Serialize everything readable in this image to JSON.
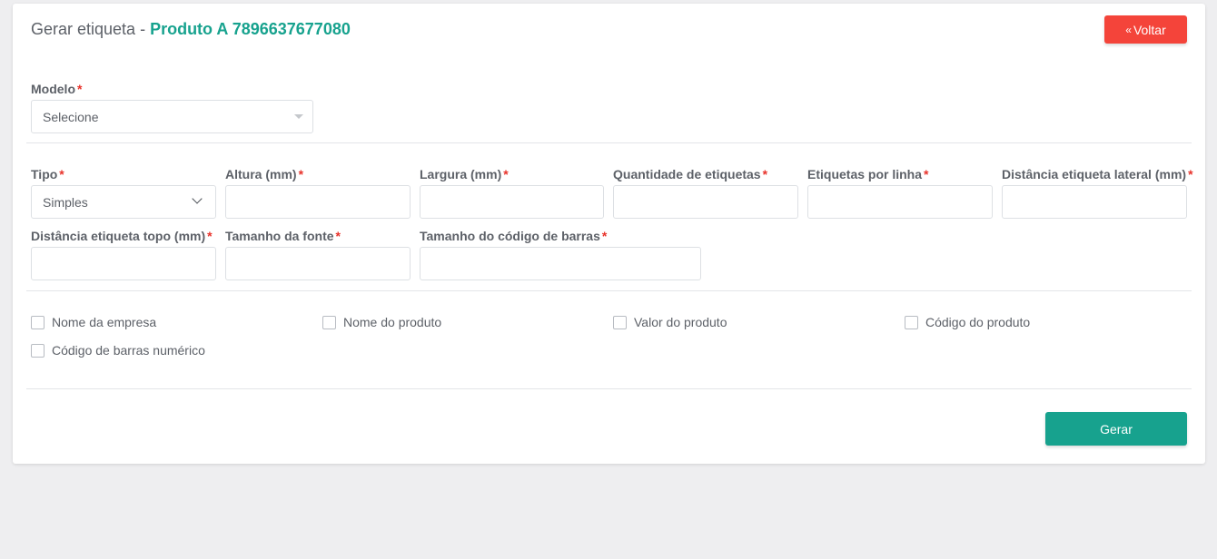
{
  "header": {
    "title_prefix": "Gerar etiqueta - ",
    "title_product": "Produto A 7896637677080",
    "back_label": "Voltar",
    "back_icon": "double-chevron-left-icon"
  },
  "modelo": {
    "label": "Modelo",
    "value": "Selecione"
  },
  "fields": {
    "tipo": {
      "label": "Tipo",
      "value": "Simples"
    },
    "altura": {
      "label": "Altura (mm)"
    },
    "largura": {
      "label": "Largura (mm)"
    },
    "quantidade": {
      "label": "Quantidade de etiquetas"
    },
    "por_linha": {
      "label": "Etiquetas por linha"
    },
    "dist_lateral": {
      "label": "Distância etiqueta lateral (mm)"
    },
    "dist_topo": {
      "label": "Distância etiqueta topo (mm)"
    },
    "tam_fonte": {
      "label": "Tamanho da fonte"
    },
    "tam_barras": {
      "label": "Tamanho do código de barras"
    }
  },
  "required_mark": "*",
  "checkboxes": [
    {
      "label": "Nome da empresa",
      "checked": false
    },
    {
      "label": "Nome do produto",
      "checked": false
    },
    {
      "label": "Valor do produto",
      "checked": false
    },
    {
      "label": "Código do produto",
      "checked": false
    },
    {
      "label": "Código de barras numérico",
      "checked": false
    }
  ],
  "actions": {
    "submit_label": "Gerar"
  },
  "colors": {
    "accent": "#17a28e",
    "danger": "#f4443a",
    "required": "#e8322a",
    "background": "#eeeef0"
  }
}
